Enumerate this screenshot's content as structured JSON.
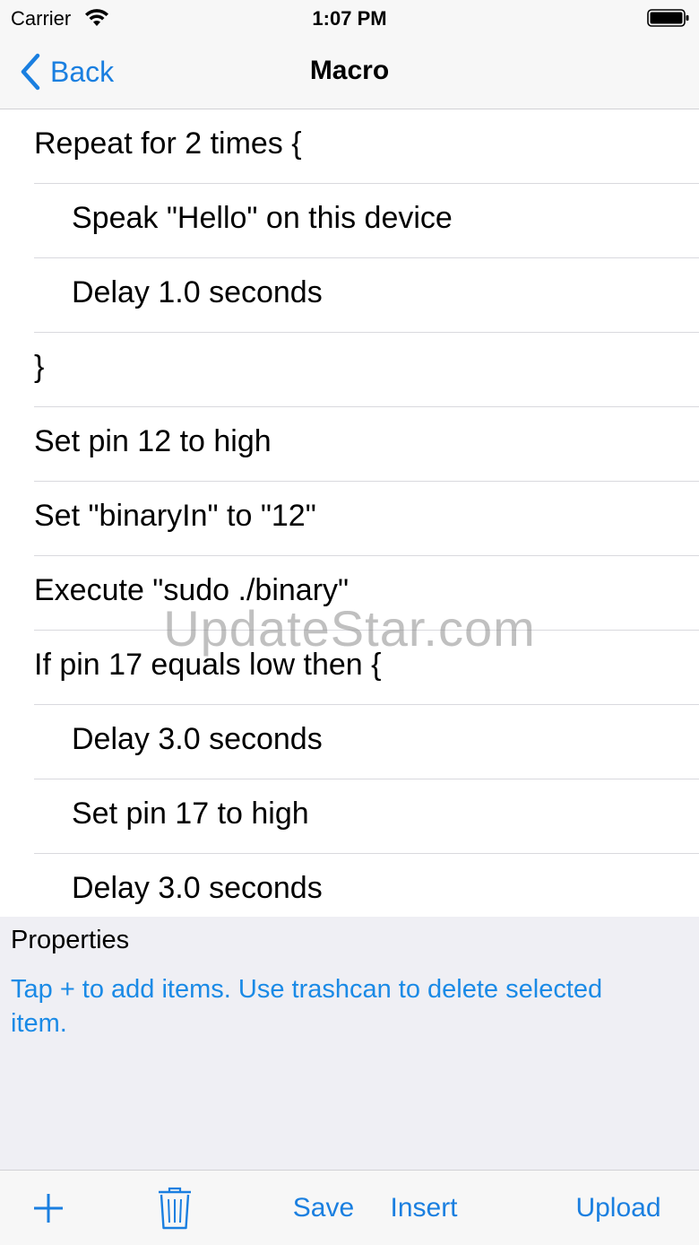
{
  "status_bar": {
    "carrier": "Carrier",
    "time": "1:07 PM",
    "icons": [
      "wifi-icon",
      "battery-icon"
    ]
  },
  "nav": {
    "back_label": "Back",
    "title": "Macro",
    "back_icon": "chevron-left-icon"
  },
  "list": {
    "items": [
      {
        "text": "Repeat for 2 times {",
        "level": 0
      },
      {
        "text": "Speak \"Hello\" on this device",
        "level": 1
      },
      {
        "text": "Delay 1.0 seconds",
        "level": 1
      },
      {
        "text": "}",
        "level": 0
      },
      {
        "text": "Set pin 12 to high",
        "level": 0
      },
      {
        "text": "Set \"binaryIn\" to \"12\"",
        "level": 0
      },
      {
        "text": "Execute \"sudo ./binary\"",
        "level": 0
      },
      {
        "text": "If pin 17 equals low then {",
        "level": 0
      },
      {
        "text": "Delay 3.0 seconds",
        "level": 1
      },
      {
        "text": "Set pin 17 to high",
        "level": 1
      },
      {
        "text": "Delay 3.0 seconds",
        "level": 1
      }
    ]
  },
  "watermark": "UpdateStar.com",
  "properties": {
    "title": "Properties",
    "hint": "Tap + to add items.  Use trashcan to delete selected item."
  },
  "toolbar": {
    "add_icon": "plus-icon",
    "trash_icon": "trash-icon",
    "save_label": "Save",
    "insert_label": "Insert",
    "upload_label": "Upload"
  },
  "colors": {
    "accent": "#1a7fe0",
    "hint": "#1a8ae6",
    "bar_background": "#f7f7f7",
    "properties_background": "#efeff4",
    "separator": "#d9d9de"
  }
}
